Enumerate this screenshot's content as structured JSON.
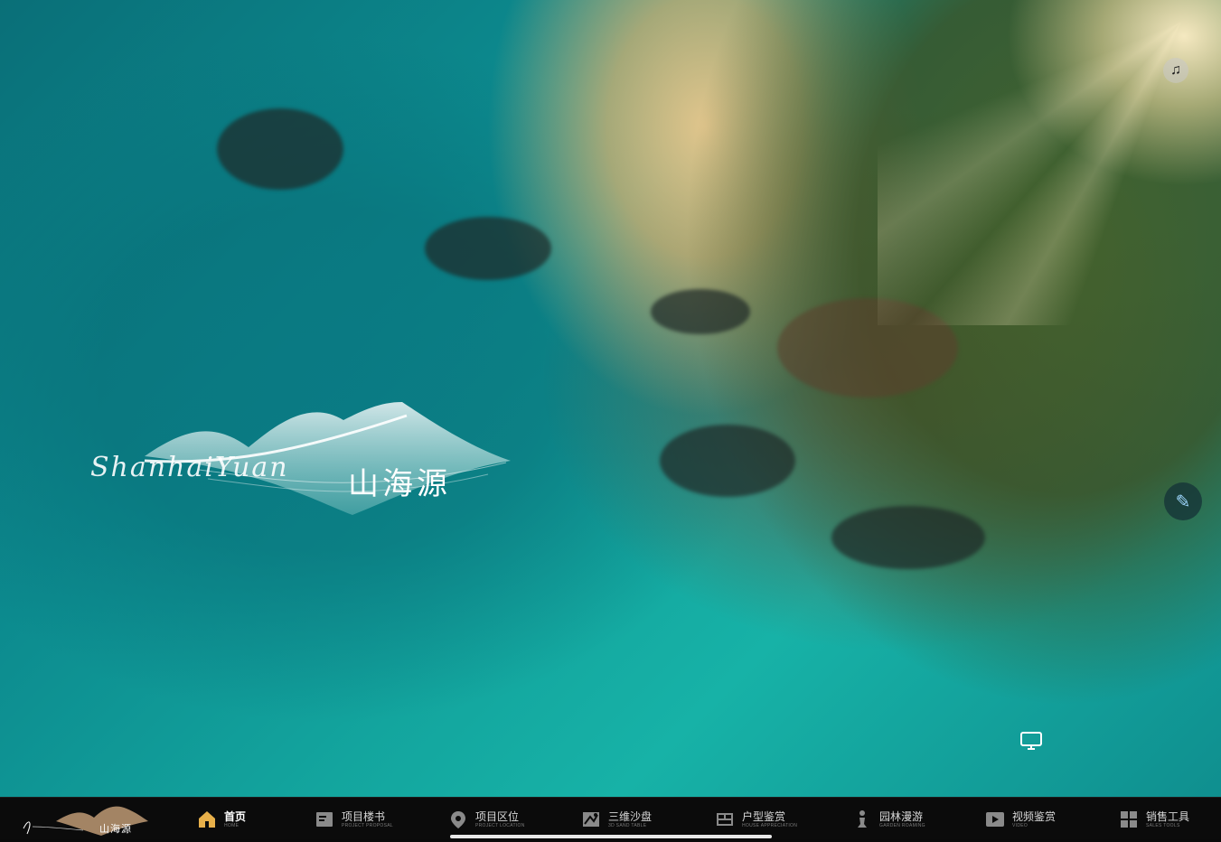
{
  "hero": {
    "logo_cn": "山海源",
    "logo_en": "ShanhaiYuan"
  },
  "floating": {
    "music_icon": "music-note-icon",
    "edit_icon": "pencil-icon",
    "screen_icon": "screen-share-icon"
  },
  "nav": {
    "logo_cn": "山海源",
    "items": [
      {
        "label": "首页",
        "sub": "HOME",
        "icon": "home-icon",
        "active": true
      },
      {
        "label": "项目楼书",
        "sub": "PROJECT PROPOSAL",
        "icon": "book-icon",
        "active": false
      },
      {
        "label": "项目区位",
        "sub": "PROJECT LOCATION",
        "icon": "location-pin-icon",
        "active": false
      },
      {
        "label": "三维沙盘",
        "sub": "3D SAND TABLE",
        "icon": "map-icon",
        "active": false
      },
      {
        "label": "户型鉴赏",
        "sub": "HOUSE APPRECIATION",
        "icon": "floorplan-icon",
        "active": false
      },
      {
        "label": "园林漫游",
        "sub": "GARDEN ROAMING",
        "icon": "walker-icon",
        "active": false
      },
      {
        "label": "视频鉴赏",
        "sub": "VIDEO",
        "icon": "play-icon",
        "active": false
      },
      {
        "label": "销售工具",
        "sub": "SALES TOOLS",
        "icon": "grid-icon",
        "active": false
      }
    ]
  },
  "colors": {
    "accent_gold": "#e8b04a",
    "nav_bg": "#0b0b0b"
  }
}
